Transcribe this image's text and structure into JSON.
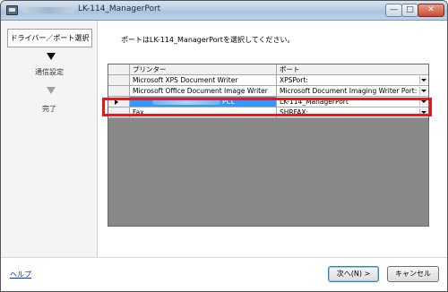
{
  "window": {
    "title": "LK-114_ManagerPort",
    "min_glyph": "—",
    "max_glyph": "□",
    "close_glyph": "✕"
  },
  "steps": [
    {
      "label": "ドライバー／ポート選択",
      "state": "active"
    },
    {
      "label": "通信設定",
      "state": "pending"
    },
    {
      "label": "完了",
      "state": "pending"
    }
  ],
  "instruction": "ポートはLK-114_ManagerPortを選択してください。",
  "grid": {
    "columns": [
      "プリンター",
      "ポート"
    ],
    "rows": [
      {
        "printer": "Microsoft XPS Document Writer",
        "port": "XPSPort:",
        "selected": false
      },
      {
        "printer": "Microsoft Office Document Image Writer",
        "port": "Microsoft Document Imaging Writer Port:",
        "selected": false
      },
      {
        "printer": "PCL",
        "port": "LK-114_ManagerPort",
        "selected": true
      },
      {
        "printer": "Fax",
        "port": "SHRFAX:",
        "selected": false
      }
    ]
  },
  "footer": {
    "help": "ヘルプ",
    "next": "次へ(N) >",
    "cancel": "キャンセル"
  },
  "colors": {
    "highlight_border": "#e8191e",
    "selection": "#3399ff",
    "link": "#0033cc"
  }
}
